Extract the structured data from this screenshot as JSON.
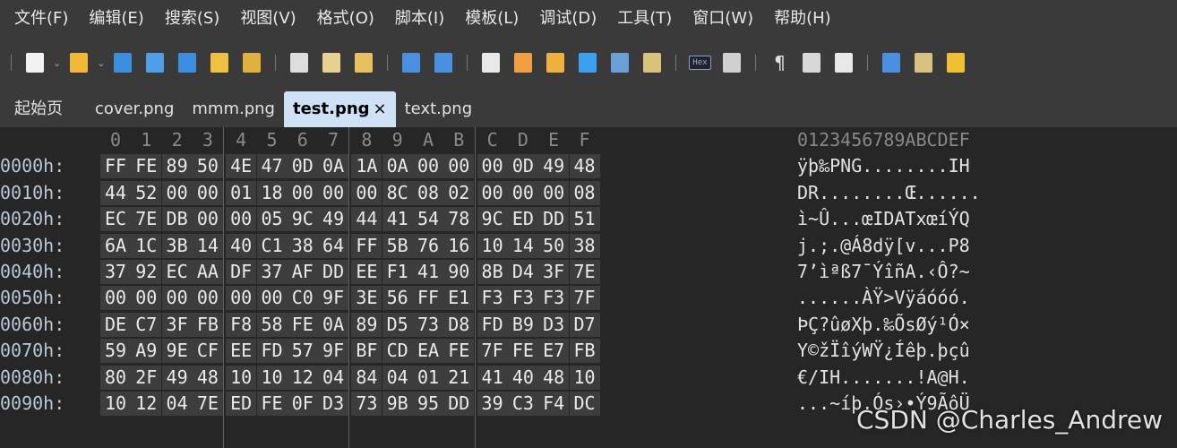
{
  "menu": [
    "文件(F)",
    "编辑(E)",
    "搜索(S)",
    "视图(V)",
    "格式(O)",
    "脚本(I)",
    "模板(L)",
    "调试(D)",
    "工具(T)",
    "窗口(W)",
    "帮助(H)"
  ],
  "toolbar": {
    "hex_label": "Hex",
    "pilcrow": "¶",
    "buttons": [
      {
        "name": "new-file-icon",
        "color": "#f2f2f2"
      },
      {
        "name": "open-folder-icon",
        "color": "#f0b93a"
      },
      {
        "name": "save-icon",
        "color": "#3c8fe0"
      },
      {
        "name": "save-as-icon",
        "color": "#4f9fe8"
      },
      {
        "name": "save-all-icon",
        "color": "#3c8fe0"
      },
      {
        "name": "open-workspace-icon",
        "color": "#f0c040"
      },
      {
        "name": "project-icon",
        "color": "#e0b040"
      },
      {
        "name": "cut-icon",
        "color": "#dddddd"
      },
      {
        "name": "copy-icon",
        "color": "#e8d090"
      },
      {
        "name": "paste-icon",
        "color": "#e8c060"
      },
      {
        "name": "undo-icon",
        "color": "#4a90e2"
      },
      {
        "name": "redo-icon",
        "color": "#4a90e2"
      },
      {
        "name": "find-icon",
        "color": "#e8e8e8"
      },
      {
        "name": "replace-icon",
        "color": "#f0a040"
      },
      {
        "name": "find-in-files-icon",
        "color": "#f0b040"
      },
      {
        "name": "goto-icon",
        "color": "#3aa0f0"
      },
      {
        "name": "run-script-icon",
        "color": "#6a9fd8"
      },
      {
        "name": "run-template-icon",
        "color": "#d9c27a"
      },
      {
        "name": "hex-view-icon",
        "color": "#8aa0c0"
      },
      {
        "name": "columns-icon",
        "color": "#d0d0d0"
      },
      {
        "name": "show-whitespace-icon",
        "color": "#e0e0e0"
      },
      {
        "name": "list-view-icon",
        "color": "#d8d8d8"
      },
      {
        "name": "highlight-icon",
        "color": "#e8e8e8"
      },
      {
        "name": "calculator-icon",
        "color": "#4a90e2"
      },
      {
        "name": "inspector-icon",
        "color": "#d8c080"
      },
      {
        "name": "compare-icon",
        "color": "#f0c030"
      }
    ]
  },
  "tabs": [
    {
      "label": "起始页",
      "active": false
    },
    {
      "label": "cover.png",
      "active": false
    },
    {
      "label": "mmm.png",
      "active": false
    },
    {
      "label": "test.png",
      "active": true,
      "close": "×"
    },
    {
      "label": "text.png",
      "active": false
    }
  ],
  "hex": {
    "column_headers": [
      "0",
      "1",
      "2",
      "3",
      "4",
      "5",
      "6",
      "7",
      "8",
      "9",
      "A",
      "B",
      "C",
      "D",
      "E",
      "F"
    ],
    "ascii_header": "0123456789ABCDEF",
    "rows": [
      {
        "offset": "0000h:",
        "bytes": [
          "FF",
          "FE",
          "89",
          "50",
          "4E",
          "47",
          "0D",
          "0A",
          "1A",
          "0A",
          "00",
          "00",
          "00",
          "0D",
          "49",
          "48"
        ],
        "ascii": "ÿþ‰PNG........IH"
      },
      {
        "offset": "0010h:",
        "bytes": [
          "44",
          "52",
          "00",
          "00",
          "01",
          "18",
          "00",
          "00",
          "00",
          "8C",
          "08",
          "02",
          "00",
          "00",
          "00",
          "08"
        ],
        "ascii": "DR........Œ......"
      },
      {
        "offset": "0020h:",
        "bytes": [
          "EC",
          "7E",
          "DB",
          "00",
          "00",
          "05",
          "9C",
          "49",
          "44",
          "41",
          "54",
          "78",
          "9C",
          "ED",
          "DD",
          "51"
        ],
        "ascii": "ì~Û...œIDATxœíÝQ"
      },
      {
        "offset": "0030h:",
        "bytes": [
          "6A",
          "1C",
          "3B",
          "14",
          "40",
          "C1",
          "38",
          "64",
          "FF",
          "5B",
          "76",
          "16",
          "10",
          "14",
          "50",
          "38"
        ],
        "ascii": "j.;.@Á8dÿ[v...P8"
      },
      {
        "offset": "0040h:",
        "bytes": [
          "37",
          "92",
          "EC",
          "AA",
          "DF",
          "37",
          "AF",
          "DD",
          "EE",
          "F1",
          "41",
          "90",
          "8B",
          "D4",
          "3F",
          "7E"
        ],
        "ascii": "7’ìªß7¯ÝîñA.‹Ô?~"
      },
      {
        "offset": "0050h:",
        "bytes": [
          "00",
          "00",
          "00",
          "00",
          "00",
          "00",
          "C0",
          "9F",
          "3E",
          "56",
          "FF",
          "E1",
          "F3",
          "F3",
          "F3",
          "7F"
        ],
        "ascii": "......ÀŸ>Vÿáóóó."
      },
      {
        "offset": "0060h:",
        "bytes": [
          "DE",
          "C7",
          "3F",
          "FB",
          "F8",
          "58",
          "FE",
          "0A",
          "89",
          "D5",
          "73",
          "D8",
          "FD",
          "B9",
          "D3",
          "D7"
        ],
        "ascii": "ÞÇ?ûøXþ.‰ÕsØý¹Ó×"
      },
      {
        "offset": "0070h:",
        "bytes": [
          "59",
          "A9",
          "9E",
          "CF",
          "EE",
          "FD",
          "57",
          "9F",
          "BF",
          "CD",
          "EA",
          "FE",
          "7F",
          "FE",
          "E7",
          "FB"
        ],
        "ascii": "Y©žÏîýWŸ¿Íêþ.þçû"
      },
      {
        "offset": "0080h:",
        "bytes": [
          "80",
          "2F",
          "49",
          "48",
          "10",
          "10",
          "12",
          "04",
          "84",
          "04",
          "01",
          "21",
          "41",
          "40",
          "48",
          "10"
        ],
        "ascii": "€/IH.......!A@H."
      },
      {
        "offset": "0090h:",
        "bytes": [
          "10",
          "12",
          "04",
          "7E",
          "ED",
          "FE",
          "0F",
          "D3",
          "73",
          "9B",
          "95",
          "DD",
          "39",
          "C3",
          "F4",
          "DC"
        ],
        "ascii": "...~íþ.Ós›•Ý9ÃôÜ"
      }
    ]
  },
  "watermark": "CSDN @Charles_Andrew"
}
